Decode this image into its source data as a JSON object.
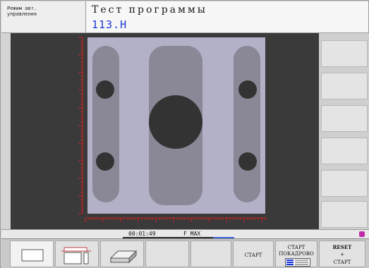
{
  "header": {
    "mode_line1": "Режим авт.",
    "mode_line2": "управления",
    "title": "Тест программы",
    "file": "113.H"
  },
  "status": {
    "time": "00:01:49",
    "feed": "F MAX"
  },
  "softkeys": {
    "start": "СТАРТ",
    "start_block_line1": "СТАРТ",
    "start_block_line2": "ПОКАДРОВО",
    "reset_line1": "RESET",
    "reset_line2": "+",
    "reset_line3": "СТАРТ"
  },
  "colors": {
    "workpiece": "#b3b1c8",
    "slot": "#8a8797",
    "hole": "#333333",
    "ruler": "#cc2222",
    "background": "#3a3a3a",
    "file_text": "#1a36d8"
  }
}
